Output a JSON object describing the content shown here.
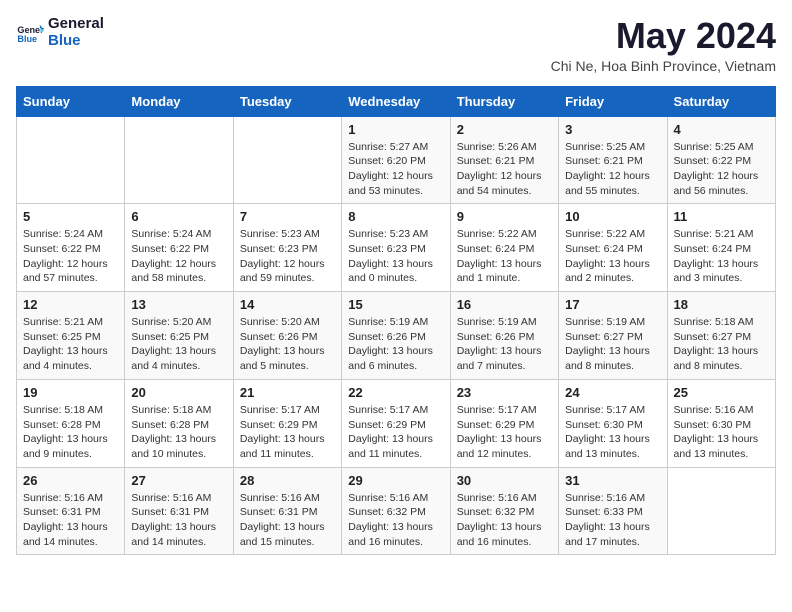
{
  "header": {
    "logo_line1": "General",
    "logo_line2": "Blue",
    "month_title": "May 2024",
    "subtitle": "Chi Ne, Hoa Binh Province, Vietnam"
  },
  "weekdays": [
    "Sunday",
    "Monday",
    "Tuesday",
    "Wednesday",
    "Thursday",
    "Friday",
    "Saturday"
  ],
  "weeks": [
    [
      {
        "day": "",
        "info": ""
      },
      {
        "day": "",
        "info": ""
      },
      {
        "day": "",
        "info": ""
      },
      {
        "day": "1",
        "info": "Sunrise: 5:27 AM\nSunset: 6:20 PM\nDaylight: 12 hours\nand 53 minutes."
      },
      {
        "day": "2",
        "info": "Sunrise: 5:26 AM\nSunset: 6:21 PM\nDaylight: 12 hours\nand 54 minutes."
      },
      {
        "day": "3",
        "info": "Sunrise: 5:25 AM\nSunset: 6:21 PM\nDaylight: 12 hours\nand 55 minutes."
      },
      {
        "day": "4",
        "info": "Sunrise: 5:25 AM\nSunset: 6:22 PM\nDaylight: 12 hours\nand 56 minutes."
      }
    ],
    [
      {
        "day": "5",
        "info": "Sunrise: 5:24 AM\nSunset: 6:22 PM\nDaylight: 12 hours\nand 57 minutes."
      },
      {
        "day": "6",
        "info": "Sunrise: 5:24 AM\nSunset: 6:22 PM\nDaylight: 12 hours\nand 58 minutes."
      },
      {
        "day": "7",
        "info": "Sunrise: 5:23 AM\nSunset: 6:23 PM\nDaylight: 12 hours\nand 59 minutes."
      },
      {
        "day": "8",
        "info": "Sunrise: 5:23 AM\nSunset: 6:23 PM\nDaylight: 13 hours\nand 0 minutes."
      },
      {
        "day": "9",
        "info": "Sunrise: 5:22 AM\nSunset: 6:24 PM\nDaylight: 13 hours\nand 1 minute."
      },
      {
        "day": "10",
        "info": "Sunrise: 5:22 AM\nSunset: 6:24 PM\nDaylight: 13 hours\nand 2 minutes."
      },
      {
        "day": "11",
        "info": "Sunrise: 5:21 AM\nSunset: 6:24 PM\nDaylight: 13 hours\nand 3 minutes."
      }
    ],
    [
      {
        "day": "12",
        "info": "Sunrise: 5:21 AM\nSunset: 6:25 PM\nDaylight: 13 hours\nand 4 minutes."
      },
      {
        "day": "13",
        "info": "Sunrise: 5:20 AM\nSunset: 6:25 PM\nDaylight: 13 hours\nand 4 minutes."
      },
      {
        "day": "14",
        "info": "Sunrise: 5:20 AM\nSunset: 6:26 PM\nDaylight: 13 hours\nand 5 minutes."
      },
      {
        "day": "15",
        "info": "Sunrise: 5:19 AM\nSunset: 6:26 PM\nDaylight: 13 hours\nand 6 minutes."
      },
      {
        "day": "16",
        "info": "Sunrise: 5:19 AM\nSunset: 6:26 PM\nDaylight: 13 hours\nand 7 minutes."
      },
      {
        "day": "17",
        "info": "Sunrise: 5:19 AM\nSunset: 6:27 PM\nDaylight: 13 hours\nand 8 minutes."
      },
      {
        "day": "18",
        "info": "Sunrise: 5:18 AM\nSunset: 6:27 PM\nDaylight: 13 hours\nand 8 minutes."
      }
    ],
    [
      {
        "day": "19",
        "info": "Sunrise: 5:18 AM\nSunset: 6:28 PM\nDaylight: 13 hours\nand 9 minutes."
      },
      {
        "day": "20",
        "info": "Sunrise: 5:18 AM\nSunset: 6:28 PM\nDaylight: 13 hours\nand 10 minutes."
      },
      {
        "day": "21",
        "info": "Sunrise: 5:17 AM\nSunset: 6:29 PM\nDaylight: 13 hours\nand 11 minutes."
      },
      {
        "day": "22",
        "info": "Sunrise: 5:17 AM\nSunset: 6:29 PM\nDaylight: 13 hours\nand 11 minutes."
      },
      {
        "day": "23",
        "info": "Sunrise: 5:17 AM\nSunset: 6:29 PM\nDaylight: 13 hours\nand 12 minutes."
      },
      {
        "day": "24",
        "info": "Sunrise: 5:17 AM\nSunset: 6:30 PM\nDaylight: 13 hours\nand 13 minutes."
      },
      {
        "day": "25",
        "info": "Sunrise: 5:16 AM\nSunset: 6:30 PM\nDaylight: 13 hours\nand 13 minutes."
      }
    ],
    [
      {
        "day": "26",
        "info": "Sunrise: 5:16 AM\nSunset: 6:31 PM\nDaylight: 13 hours\nand 14 minutes."
      },
      {
        "day": "27",
        "info": "Sunrise: 5:16 AM\nSunset: 6:31 PM\nDaylight: 13 hours\nand 14 minutes."
      },
      {
        "day": "28",
        "info": "Sunrise: 5:16 AM\nSunset: 6:31 PM\nDaylight: 13 hours\nand 15 minutes."
      },
      {
        "day": "29",
        "info": "Sunrise: 5:16 AM\nSunset: 6:32 PM\nDaylight: 13 hours\nand 16 minutes."
      },
      {
        "day": "30",
        "info": "Sunrise: 5:16 AM\nSunset: 6:32 PM\nDaylight: 13 hours\nand 16 minutes."
      },
      {
        "day": "31",
        "info": "Sunrise: 5:16 AM\nSunset: 6:33 PM\nDaylight: 13 hours\nand 17 minutes."
      },
      {
        "day": "",
        "info": ""
      }
    ]
  ]
}
